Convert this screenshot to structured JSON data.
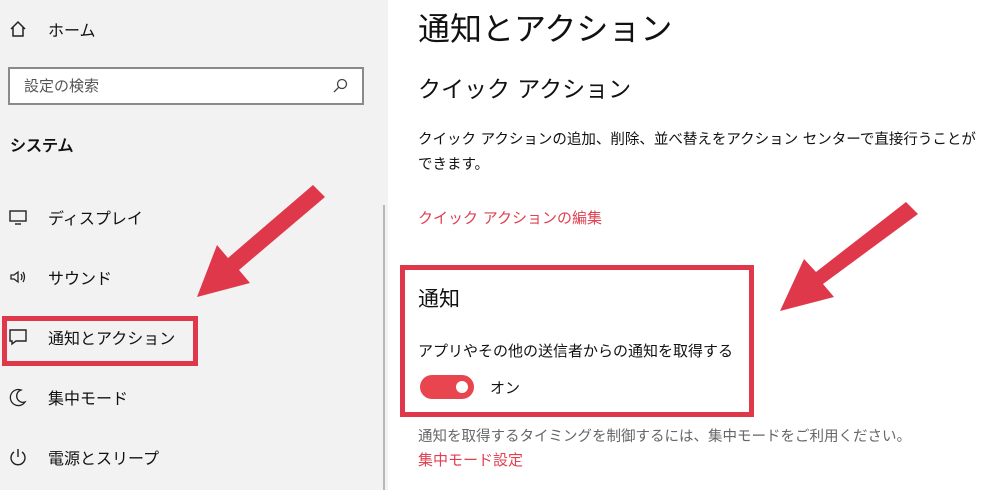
{
  "sidebar": {
    "home_label": "ホーム",
    "search_placeholder": "設定の検索",
    "section_heading": "システム",
    "items": [
      {
        "label": "ディスプレイ",
        "icon": "monitor-icon"
      },
      {
        "label": "サウンド",
        "icon": "speaker-icon"
      },
      {
        "label": "通知とアクション",
        "icon": "notification-icon",
        "selected": true
      },
      {
        "label": "集中モード",
        "icon": "moon-icon"
      },
      {
        "label": "電源とスリープ",
        "icon": "power-icon"
      }
    ]
  },
  "main": {
    "title": "通知とアクション",
    "quick_actions": {
      "heading": "クイック アクション",
      "description": "クイック アクションの追加、削除、並べ替えをアクション センターで直接行うことができます。",
      "edit_link": "クイック アクションの編集"
    },
    "notifications": {
      "heading": "通知",
      "toggle_label": "アプリやその他の送信者からの通知を取得する",
      "toggle_state": "オン",
      "toggle_on": true
    },
    "focus_info": "通知を取得するタイミングを制御するには、集中モードをご利用ください。",
    "focus_link": "集中モード設定"
  },
  "colors": {
    "accent": "#e04050",
    "highlight": "#e0384b",
    "toggle": "#e8454f"
  }
}
